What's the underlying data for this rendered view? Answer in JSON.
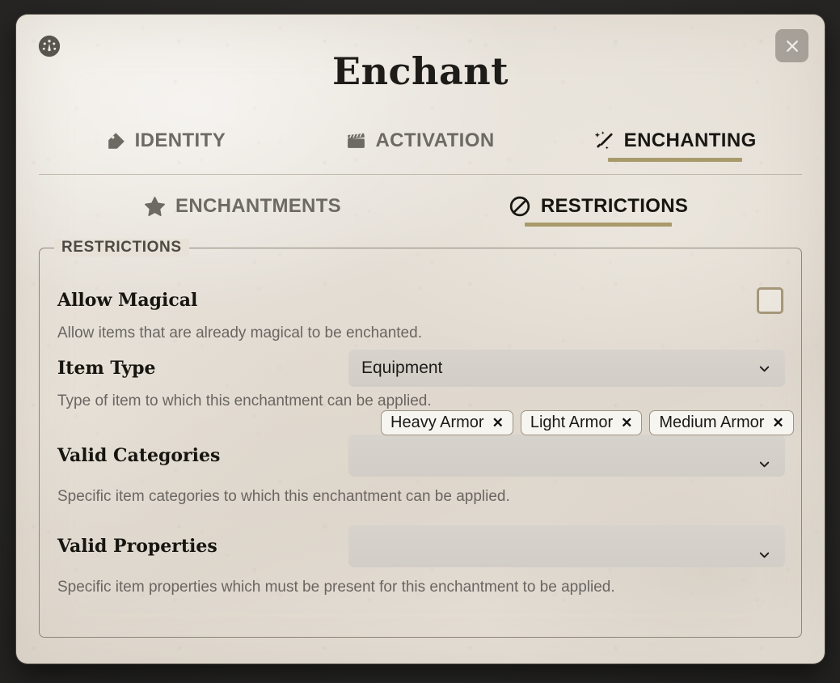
{
  "window": {
    "title": "Enchant",
    "icon": "gauge-icon",
    "close_label": "×",
    "close_icon": "close-icon"
  },
  "tabs_primary": [
    {
      "label": "IDENTITY",
      "icon": "tag-icon",
      "active": false
    },
    {
      "label": "ACTIVATION",
      "icon": "clapperboard-icon",
      "active": false
    },
    {
      "label": "ENCHANTING",
      "icon": "magic-wand-icon",
      "active": true
    }
  ],
  "tabs_secondary": [
    {
      "label": "ENCHANTMENTS",
      "icon": "star-icon",
      "active": false
    },
    {
      "label": "RESTRICTIONS",
      "icon": "ban-icon",
      "active": true
    }
  ],
  "fieldset": {
    "legend": "RESTRICTIONS",
    "rows": {
      "allow_magical": {
        "label": "Allow Magical",
        "hint": "Allow items that are already magical to be enchanted.",
        "checked": false
      },
      "item_type": {
        "label": "Item Type",
        "value": "Equipment",
        "hint": "Type of item to which this enchantment can be applied."
      },
      "valid_categories": {
        "label": "Valid Categories",
        "value": "",
        "hint": "Specific item categories to which this enchantment can be applied.",
        "chips": [
          "Heavy Armor",
          "Light Armor",
          "Medium Armor"
        ],
        "chip_remove_label": "✕"
      },
      "valid_properties": {
        "label": "Valid Properties",
        "value": "",
        "hint": "Specific item properties which must be present for this enchantment to be applied."
      }
    }
  },
  "colors": {
    "accent_underline": "#a99a6c",
    "parchment": "#e7e2da",
    "stage": "#2b2b2b",
    "checkbox_border": "#a6977a",
    "text_primary": "#17150f",
    "text_muted": "#6d6a64"
  }
}
